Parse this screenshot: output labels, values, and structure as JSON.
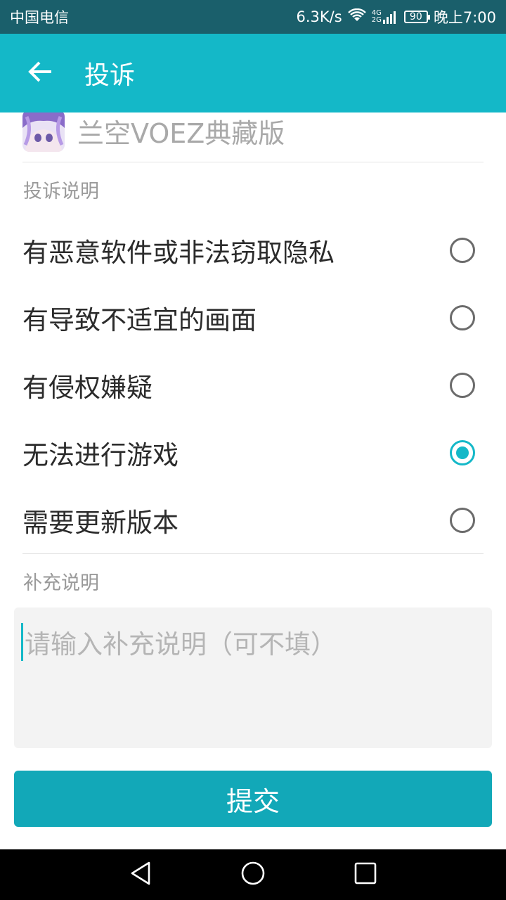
{
  "status_bar": {
    "carrier": "中国电信",
    "net_speed": "6.3K/s",
    "signal_label_top": "4G",
    "signal_label_bottom": "2G",
    "battery": "90",
    "time": "晚上7:00"
  },
  "toolbar": {
    "title": "投诉",
    "back_icon": "arrow-left-icon"
  },
  "app": {
    "name": "兰空VOEZ典藏版",
    "icon": "app-avatar-icon"
  },
  "complaint": {
    "section_label": "投诉说明",
    "options": [
      {
        "label": "有恶意软件或非法窃取隐私",
        "selected": false
      },
      {
        "label": "有导致不适宜的画面",
        "selected": false
      },
      {
        "label": "有侵权嫌疑",
        "selected": false
      },
      {
        "label": "无法进行游戏",
        "selected": true
      },
      {
        "label": "需要更新版本",
        "selected": false
      }
    ]
  },
  "supplement": {
    "section_label": "补充说明",
    "placeholder": "请输入补充说明（可不填）",
    "value": ""
  },
  "submit": {
    "label": "提交"
  },
  "colors": {
    "status_bar": "#1a5f6b",
    "toolbar": "#14b8c8",
    "accent": "#14b8c8",
    "submit_button": "#12a8b8"
  }
}
